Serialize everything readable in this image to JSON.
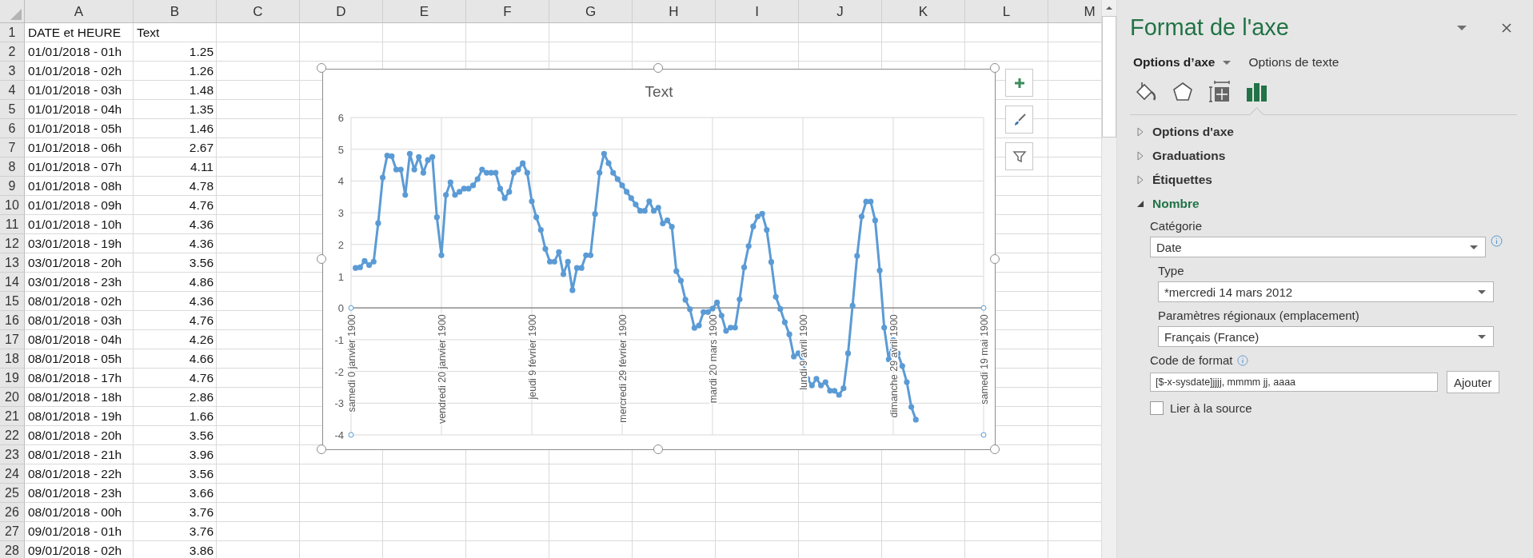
{
  "spreadsheet": {
    "columns": [
      "A",
      "B",
      "C",
      "D",
      "E",
      "F",
      "G",
      "H",
      "I",
      "J",
      "K",
      "L",
      "M"
    ],
    "rows": [
      {
        "number": "1",
        "cells": [
          "DATE et HEURE",
          "Text"
        ]
      },
      {
        "number": "2",
        "cells": [
          "01/01/2018 - 01h",
          "1.25"
        ]
      },
      {
        "number": "3",
        "cells": [
          "01/01/2018 - 02h",
          "1.26"
        ]
      },
      {
        "number": "4",
        "cells": [
          "01/01/2018 - 03h",
          "1.48"
        ]
      },
      {
        "number": "5",
        "cells": [
          "01/01/2018 - 04h",
          "1.35"
        ]
      },
      {
        "number": "6",
        "cells": [
          "01/01/2018 - 05h",
          "1.46"
        ]
      },
      {
        "number": "7",
        "cells": [
          "01/01/2018 - 06h",
          "2.67"
        ]
      },
      {
        "number": "8",
        "cells": [
          "01/01/2018 - 07h",
          "4.11"
        ]
      },
      {
        "number": "9",
        "cells": [
          "01/01/2018 - 08h",
          "4.78"
        ]
      },
      {
        "number": "10",
        "cells": [
          "01/01/2018 - 09h",
          "4.76"
        ]
      },
      {
        "number": "11",
        "cells": [
          "01/01/2018 - 10h",
          "4.36"
        ]
      },
      {
        "number": "12",
        "cells": [
          "03/01/2018 - 19h",
          "4.36"
        ]
      },
      {
        "number": "13",
        "cells": [
          "03/01/2018 - 20h",
          "3.56"
        ]
      },
      {
        "number": "14",
        "cells": [
          "03/01/2018 - 23h",
          "4.86"
        ]
      },
      {
        "number": "15",
        "cells": [
          "08/01/2018 - 02h",
          "4.36"
        ]
      },
      {
        "number": "16",
        "cells": [
          "08/01/2018 - 03h",
          "4.76"
        ]
      },
      {
        "number": "17",
        "cells": [
          "08/01/2018 - 04h",
          "4.26"
        ]
      },
      {
        "number": "18",
        "cells": [
          "08/01/2018 - 05h",
          "4.66"
        ]
      },
      {
        "number": "19",
        "cells": [
          "08/01/2018 - 17h",
          "4.76"
        ]
      },
      {
        "number": "20",
        "cells": [
          "08/01/2018 - 18h",
          "2.86"
        ]
      },
      {
        "number": "21",
        "cells": [
          "08/01/2018 - 19h",
          "1.66"
        ]
      },
      {
        "number": "22",
        "cells": [
          "08/01/2018 - 20h",
          "3.56"
        ]
      },
      {
        "number": "23",
        "cells": [
          "08/01/2018 - 21h",
          "3.96"
        ]
      },
      {
        "number": "24",
        "cells": [
          "08/01/2018 - 22h",
          "3.56"
        ]
      },
      {
        "number": "25",
        "cells": [
          "08/01/2018 - 23h",
          "3.66"
        ]
      },
      {
        "number": "26",
        "cells": [
          "08/01/2018 - 00h",
          "3.76"
        ]
      },
      {
        "number": "27",
        "cells": [
          "09/01/2018 - 01h",
          "3.76"
        ]
      },
      {
        "number": "28",
        "cells": [
          "09/01/2018 - 02h",
          "3.86"
        ]
      }
    ]
  },
  "chart": {
    "chart_data": {
      "type": "line",
      "title": "Text",
      "grid": true,
      "ylim": [
        -4,
        6
      ],
      "yticks": [
        -4,
        -3,
        -2,
        -1,
        0,
        1,
        2,
        3,
        4,
        5,
        6
      ],
      "categories": [
        "samedi 0 janvier 1900",
        null,
        null,
        null,
        null,
        null,
        null,
        null,
        null,
        null,
        null,
        null,
        null,
        null,
        null,
        null,
        null,
        null,
        null,
        null,
        "vendredi 20 janvier 1900",
        null,
        null,
        null,
        null,
        null,
        null,
        null,
        null,
        null,
        null,
        null,
        null,
        null,
        null,
        null,
        null,
        null,
        null,
        null,
        "jeudi 9 février 1900",
        null,
        null,
        null,
        null,
        null,
        null,
        null,
        null,
        null,
        null,
        null,
        null,
        null,
        null,
        null,
        null,
        null,
        null,
        null,
        "mercredi 29 février 1900",
        null,
        null,
        null,
        null,
        null,
        null,
        null,
        null,
        null,
        null,
        null,
        null,
        null,
        null,
        null,
        null,
        null,
        null,
        null,
        "mardi 20 mars 1900",
        null,
        null,
        null,
        null,
        null,
        null,
        null,
        null,
        null,
        null,
        null,
        null,
        null,
        null,
        null,
        null,
        null,
        null,
        null,
        "lundi 9 avril 1900",
        null,
        null,
        null,
        null,
        null,
        null,
        null,
        null,
        null,
        null,
        null,
        null,
        null,
        null,
        null,
        null,
        null,
        null,
        null,
        "dimanche 29 avril 1900",
        null,
        null,
        null,
        null,
        null,
        null,
        null,
        null,
        null,
        null,
        null,
        null,
        null,
        null,
        null,
        null,
        null,
        null,
        null,
        "samedi 19 mai 1900"
      ],
      "series": [
        {
          "color": "#5b9bd5",
          "marker": true,
          "values": [
            null,
            1.26,
            1.28,
            1.48,
            1.35,
            1.46,
            2.67,
            4.11,
            4.8,
            4.78,
            4.36,
            4.36,
            3.56,
            4.86,
            4.36,
            4.76,
            4.26,
            4.66,
            4.76,
            2.86,
            1.66,
            3.56,
            3.96,
            3.56,
            3.66,
            3.76,
            3.76,
            3.86,
            4.06,
            4.36,
            4.26,
            4.26,
            4.26,
            3.76,
            3.46,
            3.66,
            4.26,
            4.36,
            4.56,
            4.26,
            3.36,
            2.86,
            2.46,
            1.86,
            1.46,
            1.46,
            1.76,
            1.06,
            1.46,
            0.56,
            1.26,
            1.26,
            1.66,
            1.66,
            2.96,
            4.26,
            4.86,
            4.56,
            4.26,
            4.06,
            3.86,
            3.66,
            3.46,
            3.26,
            3.06,
            3.06,
            3.36,
            3.06,
            3.16,
            2.66,
            2.76,
            2.56,
            1.16,
            0.86,
            0.26,
            -0.04,
            -0.63,
            -0.55,
            -0.13,
            -0.13,
            -0.02,
            0.17,
            -0.24,
            -0.72,
            -0.62,
            -0.62,
            0.27,
            1.28,
            1.95,
            2.57,
            2.88,
            2.97,
            2.46,
            1.45,
            0.35,
            -0.03,
            -0.45,
            -0.83,
            -1.53,
            -1.43,
            -1.7,
            -2.23,
            -2.44,
            -2.23,
            -2.44,
            -2.34,
            -2.61,
            -2.61,
            -2.74,
            -2.53,
            -1.43,
            0.07,
            1.64,
            2.88,
            3.35,
            3.35,
            2.76,
            1.18,
            -0.62,
            -1.62,
            -1.01,
            -1.43,
            -1.83,
            -2.34,
            -3.12,
            -3.52,
            null,
            null,
            null,
            null,
            null,
            null,
            null,
            null,
            null,
            null,
            null,
            null,
            null,
            null,
            null
          ]
        }
      ]
    }
  },
  "panel": {
    "title": "Format de l'axe",
    "tabs": [
      {
        "label": "Options d’axe",
        "selected": true
      },
      {
        "label": "Options de texte",
        "selected": false
      }
    ],
    "icon_tabs": [
      {
        "kind": "fill",
        "selected": false
      },
      {
        "kind": "effects",
        "selected": false
      },
      {
        "kind": "size",
        "selected": false
      },
      {
        "kind": "options",
        "selected": true
      }
    ],
    "sections": [
      {
        "label": "Options d'axe",
        "expanded": false
      },
      {
        "label": "Graduations",
        "expanded": false
      },
      {
        "label": "Étiquettes",
        "expanded": false
      },
      {
        "label": "Nombre",
        "expanded": true
      }
    ],
    "number": {
      "category_label": "Catégorie",
      "category": "Date",
      "type_label": "Type",
      "type": "*mercredi 14 mars 2012",
      "locale_label": "Paramètres régionaux (emplacement)",
      "locale": "Français (France)",
      "format_code_label": "Code de format",
      "format_code": "[$-x-sysdate]jjjj, mmmm jj, aaaa",
      "add_button": "Ajouter",
      "link_source": {
        "label": "Lier à la source",
        "checked": false
      }
    }
  }
}
